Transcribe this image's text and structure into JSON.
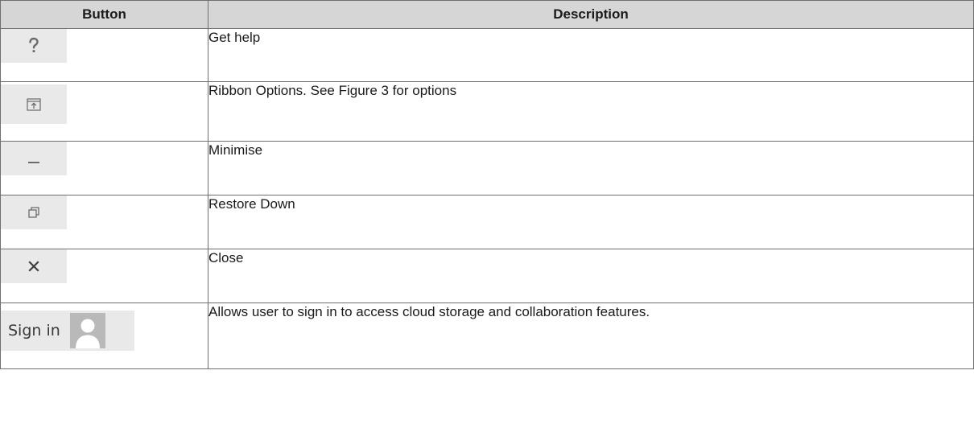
{
  "table": {
    "headers": {
      "button": "Button",
      "description": "Description"
    },
    "rows": [
      {
        "icon": "help-question-icon",
        "description": "Get help"
      },
      {
        "icon": "ribbon-options-icon",
        "description": "Ribbon Options. See Figure 3 for options"
      },
      {
        "icon": "minimise-icon",
        "description": "Minimise"
      },
      {
        "icon": "restore-down-icon",
        "description": "Restore Down"
      },
      {
        "icon": "close-icon",
        "description": "Close"
      },
      {
        "icon": "user-avatar-icon",
        "button_label": "Sign in",
        "description": "Allows user to sign in to access cloud storage and collaboration features."
      }
    ]
  }
}
